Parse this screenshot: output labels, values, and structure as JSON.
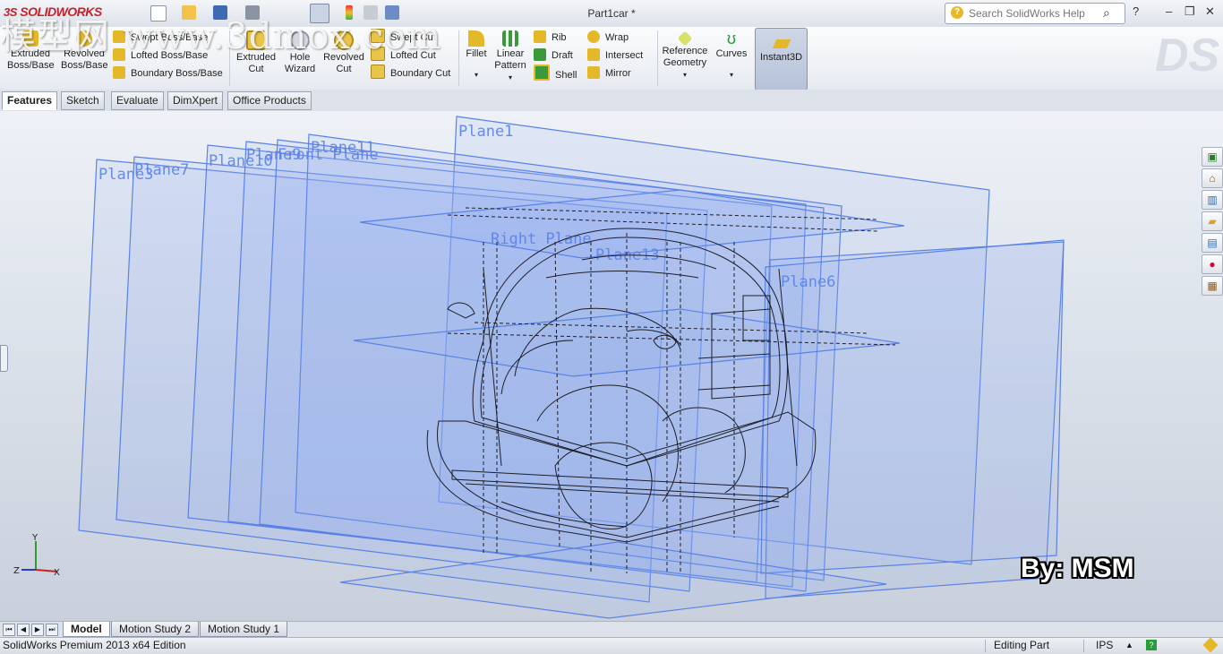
{
  "app": {
    "logo_text": "SOLIDWORKS",
    "document_title": "Part1car *",
    "watermark_text": "模型网 www.3dmox.com",
    "brand_mark": "DS"
  },
  "search": {
    "placeholder": "Search SolidWorks Help"
  },
  "window_controls": {
    "help": "?",
    "minimize": "–",
    "restore": "❐",
    "close": "✕"
  },
  "ribbon": {
    "extruded_boss": "Extruded\nBoss/Base",
    "revolved_boss": "Revolved\nBoss/Base",
    "swept_boss": "Swept Boss/Base",
    "lofted_boss": "Lofted Boss/Base",
    "boundary_boss": "Boundary Boss/Base",
    "extruded_cut": "Extruded\nCut",
    "hole_wizard": "Hole\nWizard",
    "revolved_cut": "Revolved\nCut",
    "swept_cut": "Swept Cut",
    "lofted_cut": "Lofted Cut",
    "boundary_cut": "Boundary Cut",
    "fillet": "Fillet",
    "linear_pattern": "Linear\nPattern",
    "rib": "Rib",
    "draft": "Draft",
    "shell": "Shell",
    "wrap": "Wrap",
    "intersect": "Intersect",
    "mirror": "Mirror",
    "reference_geometry": "Reference\nGeometry",
    "curves": "Curves",
    "instant3d": "Instant3D"
  },
  "command_tabs": [
    "Features",
    "Sketch",
    "Evaluate",
    "DimXpert",
    "Office Products"
  ],
  "viewport": {
    "planes": [
      "Plane1",
      "Plane3",
      "Plane7",
      "Plane10",
      "Plane9",
      "Plane11",
      "Front Plane",
      "Right Plane",
      "Plane13",
      "Plane6"
    ],
    "credit": "By: MSM",
    "triad": {
      "x": "X",
      "y": "Y",
      "z": "Z"
    }
  },
  "bottom_tabs": [
    "Model",
    "Motion Study 2",
    "Motion Study 1"
  ],
  "status": {
    "edition": "SolidWorks Premium 2013 x64 Edition",
    "mode": "Editing Part",
    "units": "IPS"
  },
  "colors": {
    "plane_edge": "#5a82e6",
    "plane_fill": "#8eaaf0",
    "wire": "#1e1e28",
    "logo_red": "#c8202a"
  }
}
